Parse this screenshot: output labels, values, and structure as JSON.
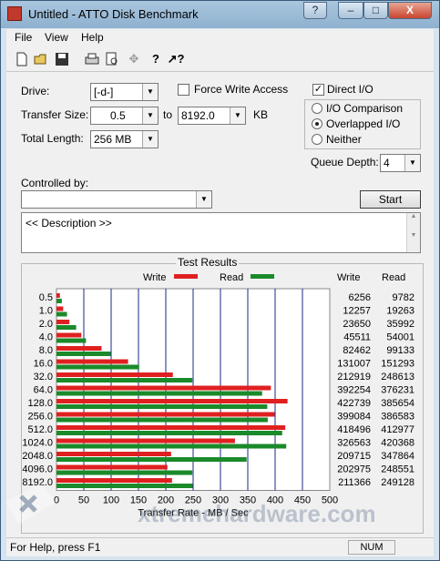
{
  "window": {
    "title": "Untitled - ATTO Disk Benchmark",
    "help_btn": "?",
    "close_btn": "X"
  },
  "menu": [
    "File",
    "View",
    "Help"
  ],
  "toolbar": {
    "icons": [
      "new-icon",
      "open-icon",
      "save-icon",
      "print-icon",
      "print-preview-icon",
      "move-icon",
      "help-icon",
      "context-help-icon"
    ]
  },
  "controls": {
    "drive_label": "Drive:",
    "drive_value": "[-d-]",
    "force_write_label": "Force Write Access",
    "direct_io_label": "Direct I/O",
    "direct_io_checked": true,
    "transfer_size_label": "Transfer Size:",
    "transfer_from": "0.5",
    "to_label": "to",
    "transfer_to": "8192.0",
    "kb_label": "KB",
    "total_length_label": "Total Length:",
    "total_length_value": "256 MB",
    "io_comparison_label": "I/O Comparison",
    "overlapped_io_label": "Overlapped I/O",
    "neither_label": "Neither",
    "queue_depth_label": "Queue Depth:",
    "queue_depth_value": "4",
    "controlled_by_label": "Controlled by:",
    "controlled_by_value": "",
    "start_label": "Start",
    "description": "<< Description >>"
  },
  "results": {
    "title": "Test Results",
    "write_legend": "Write",
    "read_legend": "Read",
    "write_header": "Write",
    "read_header": "Read",
    "write_color": "#e02020",
    "read_color": "#1a8a2a"
  },
  "chart_data": {
    "type": "bar",
    "orientation": "horizontal",
    "title": "Test Results",
    "xlabel": "Transfer Rate - MB / Sec",
    "xlim": [
      0,
      500
    ],
    "xticks": [
      "0",
      "50",
      "100",
      "150",
      "200",
      "250",
      "300",
      "350",
      "400",
      "450",
      "500"
    ],
    "categories": [
      "0.5",
      "1.0",
      "2.0",
      "4.0",
      "8.0",
      "16.0",
      "32.0",
      "64.0",
      "128.0",
      "256.0",
      "512.0",
      "1024.0",
      "2048.0",
      "4096.0",
      "8192.0"
    ],
    "series": [
      {
        "name": "Write",
        "values": [
          6256,
          12257,
          23650,
          45511,
          82462,
          131007,
          212919,
          392254,
          422739,
          399084,
          418496,
          326563,
          209715,
          202975,
          211366
        ]
      },
      {
        "name": "Read",
        "values": [
          9782,
          19263,
          35992,
          54001,
          99133,
          151293,
          248613,
          376231,
          385654,
          386583,
          412977,
          420368,
          347864,
          248551,
          249128
        ]
      }
    ],
    "grid": true,
    "legend": "top"
  },
  "status": {
    "text": "For Help, press F1",
    "num": "NUM"
  },
  "watermark": "xtremehardware.com"
}
